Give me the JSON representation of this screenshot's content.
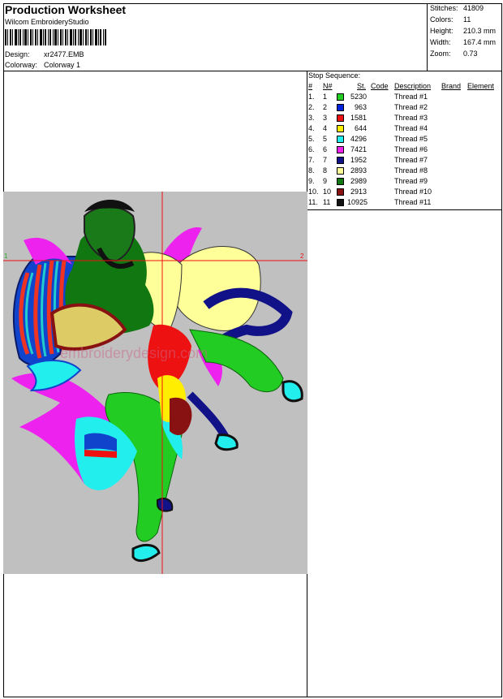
{
  "header": {
    "title": "Production Worksheet",
    "software": "Wilcom EmbroideryStudio",
    "design_label": "Design:",
    "design_value": "xr2477.EMB",
    "colorway_label": "Colorway:",
    "colorway_value": "Colorway 1"
  },
  "stats": {
    "stitches_label": "Stitches:",
    "stitches_value": "41809",
    "colors_label": "Colors:",
    "colors_value": "11",
    "height_label": "Height:",
    "height_value": "210.3 mm",
    "width_label": "Width:",
    "width_value": "167.4 mm",
    "zoom_label": "Zoom:",
    "zoom_value": "0.73"
  },
  "sequence": {
    "title": "Stop Sequence:",
    "columns": [
      "#",
      "N#",
      "St.",
      "Code",
      "Description",
      "Brand",
      "Element"
    ],
    "rows": [
      {
        "num": "1.",
        "n": "1",
        "color": "#22cc22",
        "st": "5230",
        "desc": "Thread #1"
      },
      {
        "num": "2.",
        "n": "2",
        "color": "#0022dd",
        "st": "963",
        "desc": "Thread #2"
      },
      {
        "num": "3.",
        "n": "3",
        "color": "#ee1111",
        "st": "1581",
        "desc": "Thread #3"
      },
      {
        "num": "4.",
        "n": "4",
        "color": "#ffee00",
        "st": "644",
        "desc": "Thread #4"
      },
      {
        "num": "5.",
        "n": "5",
        "color": "#22eeee",
        "st": "4296",
        "desc": "Thread #5"
      },
      {
        "num": "6.",
        "n": "6",
        "color": "#ee22ee",
        "st": "7421",
        "desc": "Thread #6"
      },
      {
        "num": "7.",
        "n": "7",
        "color": "#111188",
        "st": "1952",
        "desc": "Thread #7"
      },
      {
        "num": "8.",
        "n": "8",
        "color": "#ffff99",
        "st": "2893",
        "desc": "Thread #8"
      },
      {
        "num": "9.",
        "n": "9",
        "color": "#117711",
        "st": "2989",
        "desc": "Thread #9"
      },
      {
        "num": "10.",
        "n": "10",
        "color": "#881111",
        "st": "2913",
        "desc": "Thread #10"
      },
      {
        "num": "11.",
        "n": "11",
        "color": "#111111",
        "st": "10925",
        "desc": "Thread #11"
      }
    ]
  },
  "preview": {
    "marker_left": "1",
    "marker_right": "2",
    "watermark": "embroiderydesign.com"
  }
}
